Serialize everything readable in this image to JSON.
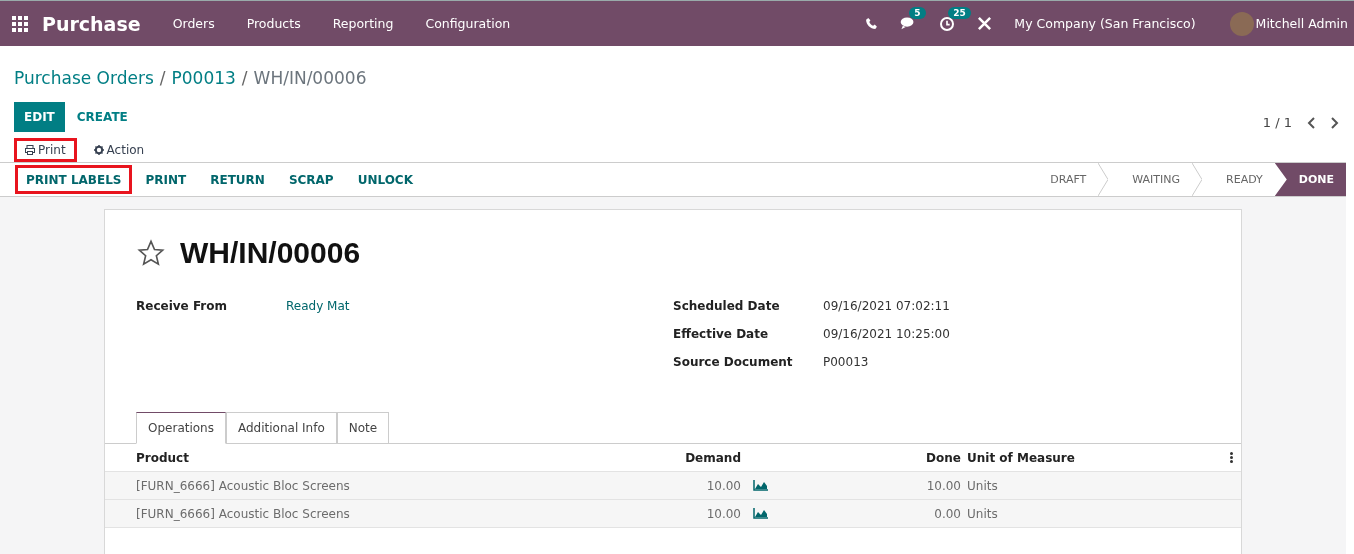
{
  "navbar": {
    "app_title": "Purchase",
    "menu": [
      "Orders",
      "Products",
      "Reporting",
      "Configuration"
    ],
    "messages_badge": "5",
    "activities_badge": "25",
    "company": "My Company (San Francisco)",
    "user": "Mitchell Admin"
  },
  "breadcrumb": {
    "links": [
      "Purchase Orders",
      "P00013"
    ],
    "current": "WH/IN/00006",
    "separator": "/"
  },
  "buttons": [
    {
      "label": "EDIT",
      "kind": "primary"
    },
    {
      "label": "CREATE",
      "kind": "secondary"
    }
  ],
  "sidebar_actions": [
    {
      "label": "Print",
      "kind": "print",
      "highlighted": true
    },
    {
      "label": "Action",
      "kind": "action",
      "highlighted": false
    }
  ],
  "pager": {
    "value": "1 / 1"
  },
  "header_buttons": [
    {
      "label": "PRINT LABELS",
      "highlighted": true
    },
    {
      "label": "PRINT",
      "highlighted": false
    },
    {
      "label": "RETURN",
      "highlighted": false
    },
    {
      "label": "SCRAP",
      "highlighted": false
    },
    {
      "label": "UNLOCK",
      "highlighted": false
    }
  ],
  "status_steps": [
    {
      "label": "DRAFT",
      "selected": false
    },
    {
      "label": "WAITING",
      "selected": false
    },
    {
      "label": "READY",
      "selected": false
    },
    {
      "label": "DONE",
      "selected": true
    }
  ],
  "record": {
    "title": "WH/IN/00006",
    "starred": false,
    "left_fields": [
      {
        "label": "Receive From",
        "value": "Ready Mat",
        "link": true
      }
    ],
    "right_fields": [
      {
        "label": "Scheduled Date",
        "value": "09/16/2021 07:02:11",
        "link": false
      },
      {
        "label": "Effective Date",
        "value": "09/16/2021 10:25:00",
        "link": false
      },
      {
        "label": "Source Document",
        "value": "P00013",
        "link": false
      }
    ]
  },
  "tabs": [
    {
      "label": "Operations",
      "selected": true
    },
    {
      "label": "Additional Info",
      "selected": false
    },
    {
      "label": "Note",
      "selected": false
    }
  ],
  "table": {
    "columns": [
      "Product",
      "Demand",
      "Done",
      "Unit of Measure"
    ],
    "rows": [
      {
        "product": "[FURN_6666] Acoustic Bloc Screens",
        "demand": "10.00",
        "done": "10.00",
        "unit": "Units"
      },
      {
        "product": "[FURN_6666] Acoustic Bloc Screens",
        "demand": "10.00",
        "done": "0.00",
        "unit": "Units"
      }
    ]
  }
}
